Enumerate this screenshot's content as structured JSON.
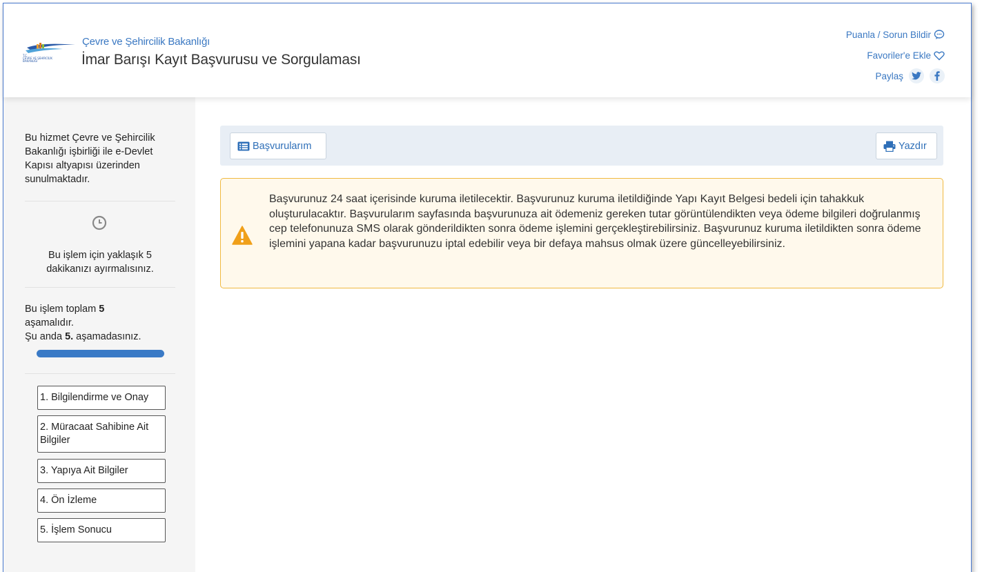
{
  "header": {
    "ministry": "Çevre ve Şehircilik Bakanlığı",
    "title": "İmar Barışı Kayıt Başvurusu ve Sorgulaması",
    "actions": {
      "rate": "Puanla / Sorun Bildir",
      "favorites": "Favoriler'e Ekle",
      "share": "Paylaş"
    },
    "icons": [
      "comment-icon",
      "heart-icon",
      "twitter-icon",
      "facebook-icon"
    ]
  },
  "sidebar": {
    "intro": "Bu hizmet Çevre ve Şehircilik Bakanlığı işbirliği ile e-Devlet Kapısı altyapısı üzerinden sunulmaktadır.",
    "time_note": "Bu işlem için yaklaşık 5 dakikanızı ayırmalısınız.",
    "total_prefix": "Bu işlem toplam ",
    "total_count": "5",
    "total_suffix": " aşamalıdır.",
    "current_prefix": "Şu anda ",
    "current_step": "5.",
    "current_suffix": " aşamadasınız.",
    "progress_fraction": 1.0,
    "steps": [
      {
        "label": "1. Bilgilendirme ve Onay"
      },
      {
        "label": "2. Müracaat Sahibine Ait Bilgiler"
      },
      {
        "label": "3. Yapıya Ait Bilgiler"
      },
      {
        "label": "4. Ön İzleme"
      },
      {
        "label": "5. İşlem Sonucu"
      }
    ]
  },
  "toolbar": {
    "applications_label": "Başvurularım",
    "print_label": "Yazdır"
  },
  "warning": {
    "text": "Başvurunuz 24 saat içerisinde kuruma iletilecektir. Başvurunuz kuruma iletildiğinde Yapı Kayıt Belgesi bedeli için tahakkuk oluşturulacaktır. Başvurularım sayfasında başvurunuza ait ödemeniz gereken tutar görüntülendikten veya ödeme bilgileri doğrulanmış cep telefonunuza SMS olarak gönderildikten sonra ödeme işlemini gerçekleştirebilirsiniz. Başvurunuz kuruma iletildikten sonra ödeme işlemini yapana kadar başvurunuzu iptal edebilir veya bir defaya mahsus olmak üzere güncelleyebilirsiniz."
  },
  "colors": {
    "accent": "#3a78c2",
    "warning_border": "#f0b93f",
    "warning_bg": "#fff9ec",
    "sidebar_bg": "#f5f5f5"
  }
}
